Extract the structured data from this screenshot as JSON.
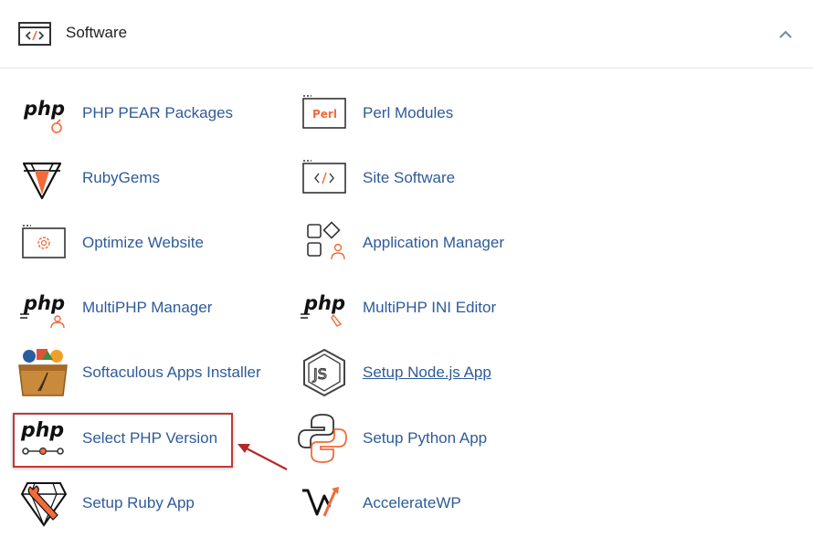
{
  "section": {
    "title": "Software",
    "icon": "code-window-icon",
    "collapse_icon": "chevron-up-icon"
  },
  "items": [
    {
      "label": "PHP PEAR Packages",
      "icon": "php-pear-icon"
    },
    {
      "label": "Perl Modules",
      "icon": "perl-icon",
      "badge": "Perl"
    },
    {
      "label": "RubyGems",
      "icon": "ruby-gem-icon"
    },
    {
      "label": "Site Software",
      "icon": "code-window-icon"
    },
    {
      "label": "Optimize Website",
      "icon": "gear-window-icon"
    },
    {
      "label": "Application Manager",
      "icon": "app-grid-icon"
    },
    {
      "label": "MultiPHP Manager",
      "icon": "php-user-icon"
    },
    {
      "label": "MultiPHP INI Editor",
      "icon": "php-editor-icon"
    },
    {
      "label": "Softaculous Apps Installer",
      "icon": "softaculous-box-icon"
    },
    {
      "label": "Setup Node.js App",
      "icon": "nodejs-hex-icon"
    },
    {
      "label": "Select PHP Version",
      "icon": "php-slider-icon",
      "highlighted": true
    },
    {
      "label": "Setup Python App",
      "icon": "python-logo-icon"
    },
    {
      "label": "Setup Ruby App",
      "icon": "ruby-wrench-icon"
    },
    {
      "label": "AccelerateWP",
      "icon": "acceleratewp-logo-icon"
    }
  ],
  "icon_text": {
    "php": "php",
    "perl": "Perl",
    "js": "JS"
  },
  "colors": {
    "link": "#2e5b99",
    "accent": "#f26b3a",
    "highlight": "#c0393b"
  }
}
